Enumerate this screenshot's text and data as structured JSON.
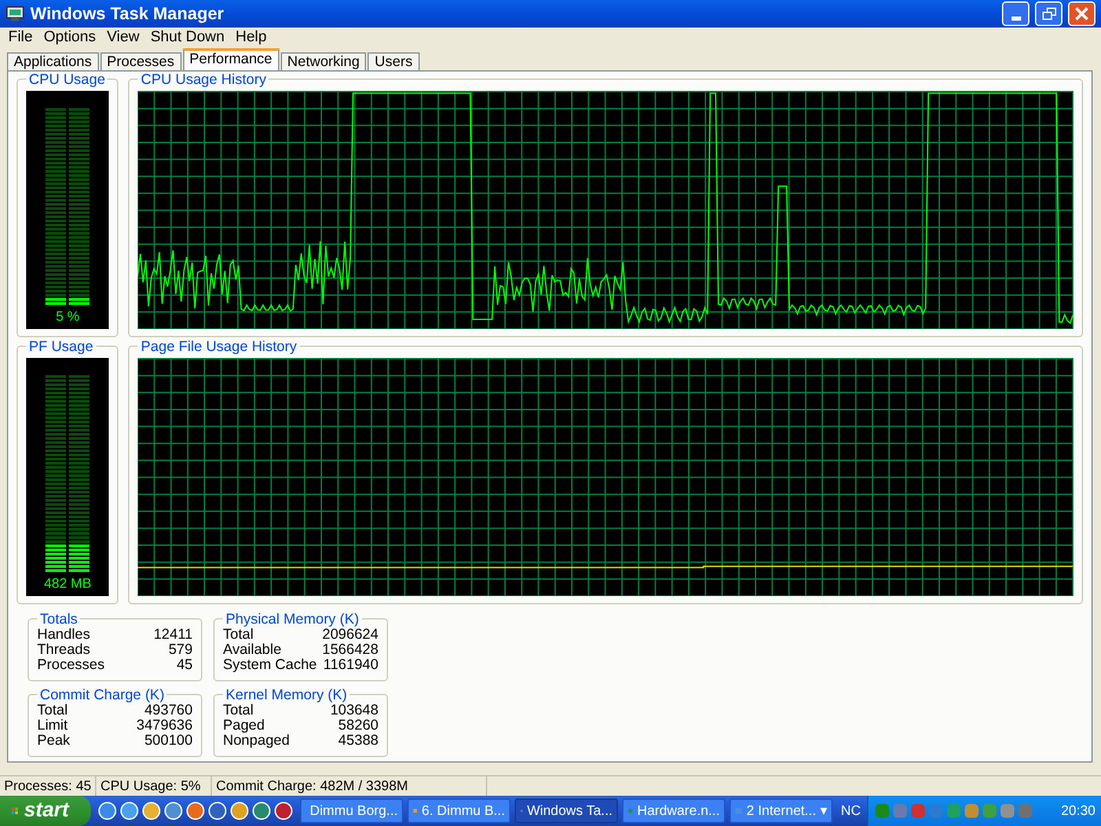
{
  "window": {
    "title": "Windows Task Manager"
  },
  "menu": [
    "File",
    "Options",
    "View",
    "Shut Down",
    "Help"
  ],
  "tabs": [
    {
      "label": "Applications",
      "selected": false
    },
    {
      "label": "Processes",
      "selected": false
    },
    {
      "label": "Performance",
      "selected": true
    },
    {
      "label": "Networking",
      "selected": false
    },
    {
      "label": "Users",
      "selected": false
    }
  ],
  "cpu_usage": {
    "title": "CPU Usage",
    "reading": "5 %",
    "level": 0.05
  },
  "cpu_history": {
    "title": "CPU Usage History"
  },
  "pf_usage": {
    "title": "PF Usage",
    "reading": "482 MB",
    "level": 0.14
  },
  "pf_history": {
    "title": "Page File Usage History"
  },
  "groups": [
    {
      "title": "Totals",
      "rows": [
        {
          "label": "Handles",
          "value": "12411"
        },
        {
          "label": "Threads",
          "value": "579"
        },
        {
          "label": "Processes",
          "value": "45"
        }
      ]
    },
    {
      "title": "Physical Memory (K)",
      "rows": [
        {
          "label": "Total",
          "value": "2096624"
        },
        {
          "label": "Available",
          "value": "1566428"
        },
        {
          "label": "System Cache",
          "value": "1161940"
        }
      ]
    },
    {
      "title": "Commit Charge (K)",
      "rows": [
        {
          "label": "Total",
          "value": "493760"
        },
        {
          "label": "Limit",
          "value": "3479636"
        },
        {
          "label": "Peak",
          "value": "500100"
        }
      ]
    },
    {
      "title": "Kernel Memory (K)",
      "rows": [
        {
          "label": "Total",
          "value": "103648"
        },
        {
          "label": "Paged",
          "value": "58260"
        },
        {
          "label": "Nonpaged",
          "value": "45388"
        }
      ]
    }
  ],
  "status_bar": [
    "Processes: 45",
    "CPU Usage: 5%",
    "Commit Charge: 482M / 3398M"
  ],
  "taskbar": {
    "start": "start",
    "tasks": [
      {
        "label": "Dimmu Borg...",
        "selected": false
      },
      {
        "label": "6. Dimmu B...",
        "selected": false
      },
      {
        "label": "Windows Ta...",
        "selected": true
      },
      {
        "label": "Hardware.n...",
        "selected": false
      },
      {
        "label": "2 Internet...",
        "selected": false,
        "caret": "▾"
      }
    ],
    "language": "NC",
    "clock": "20:30"
  }
}
